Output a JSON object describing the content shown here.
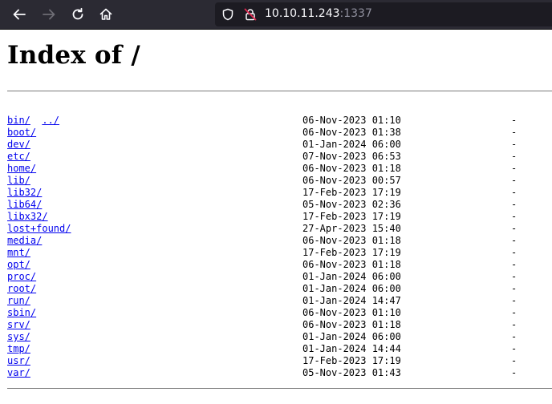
{
  "browser": {
    "url_host": "10.10.11.243",
    "url_port": ":1337",
    "icons": [
      "back-arrow-icon",
      "forward-arrow-icon",
      "reload-icon",
      "home-icon",
      "shield-icon",
      "insecure-lock-icon"
    ]
  },
  "page": {
    "title": "Index of /",
    "parent_link": "../",
    "entries": [
      {
        "name": "bin/",
        "date": "06-Nov-2023 01:10",
        "size": "-"
      },
      {
        "name": "boot/",
        "date": "06-Nov-2023 01:38",
        "size": "-"
      },
      {
        "name": "dev/",
        "date": "01-Jan-2024 06:00",
        "size": "-"
      },
      {
        "name": "etc/",
        "date": "07-Nov-2023 06:53",
        "size": "-"
      },
      {
        "name": "home/",
        "date": "06-Nov-2023 01:18",
        "size": "-"
      },
      {
        "name": "lib/",
        "date": "06-Nov-2023 00:57",
        "size": "-"
      },
      {
        "name": "lib32/",
        "date": "17-Feb-2023 17:19",
        "size": "-"
      },
      {
        "name": "lib64/",
        "date": "05-Nov-2023 02:36",
        "size": "-"
      },
      {
        "name": "libx32/",
        "date": "17-Feb-2023 17:19",
        "size": "-"
      },
      {
        "name": "lost+found/",
        "date": "27-Apr-2023 15:40",
        "size": "-"
      },
      {
        "name": "media/",
        "date": "06-Nov-2023 01:18",
        "size": "-"
      },
      {
        "name": "mnt/",
        "date": "17-Feb-2023 17:19",
        "size": "-"
      },
      {
        "name": "opt/",
        "date": "06-Nov-2023 01:18",
        "size": "-"
      },
      {
        "name": "proc/",
        "date": "01-Jan-2024 06:00",
        "size": "-"
      },
      {
        "name": "root/",
        "date": "01-Jan-2024 06:00",
        "size": "-"
      },
      {
        "name": "run/",
        "date": "01-Jan-2024 14:47",
        "size": "-"
      },
      {
        "name": "sbin/",
        "date": "06-Nov-2023 01:10",
        "size": "-"
      },
      {
        "name": "srv/",
        "date": "06-Nov-2023 01:18",
        "size": "-"
      },
      {
        "name": "sys/",
        "date": "01-Jan-2024 06:00",
        "size": "-"
      },
      {
        "name": "tmp/",
        "date": "01-Jan-2024 14:44",
        "size": "-"
      },
      {
        "name": "usr/",
        "date": "17-Feb-2023 17:19",
        "size": "-"
      },
      {
        "name": "var/",
        "date": "05-Nov-2023 01:43",
        "size": "-"
      }
    ]
  },
  "colors": {
    "toolbar_bg": "#2b2a33",
    "urlbar_bg": "#1c1b22",
    "link": "#0000ee",
    "insecure_lock": "#e22850"
  }
}
